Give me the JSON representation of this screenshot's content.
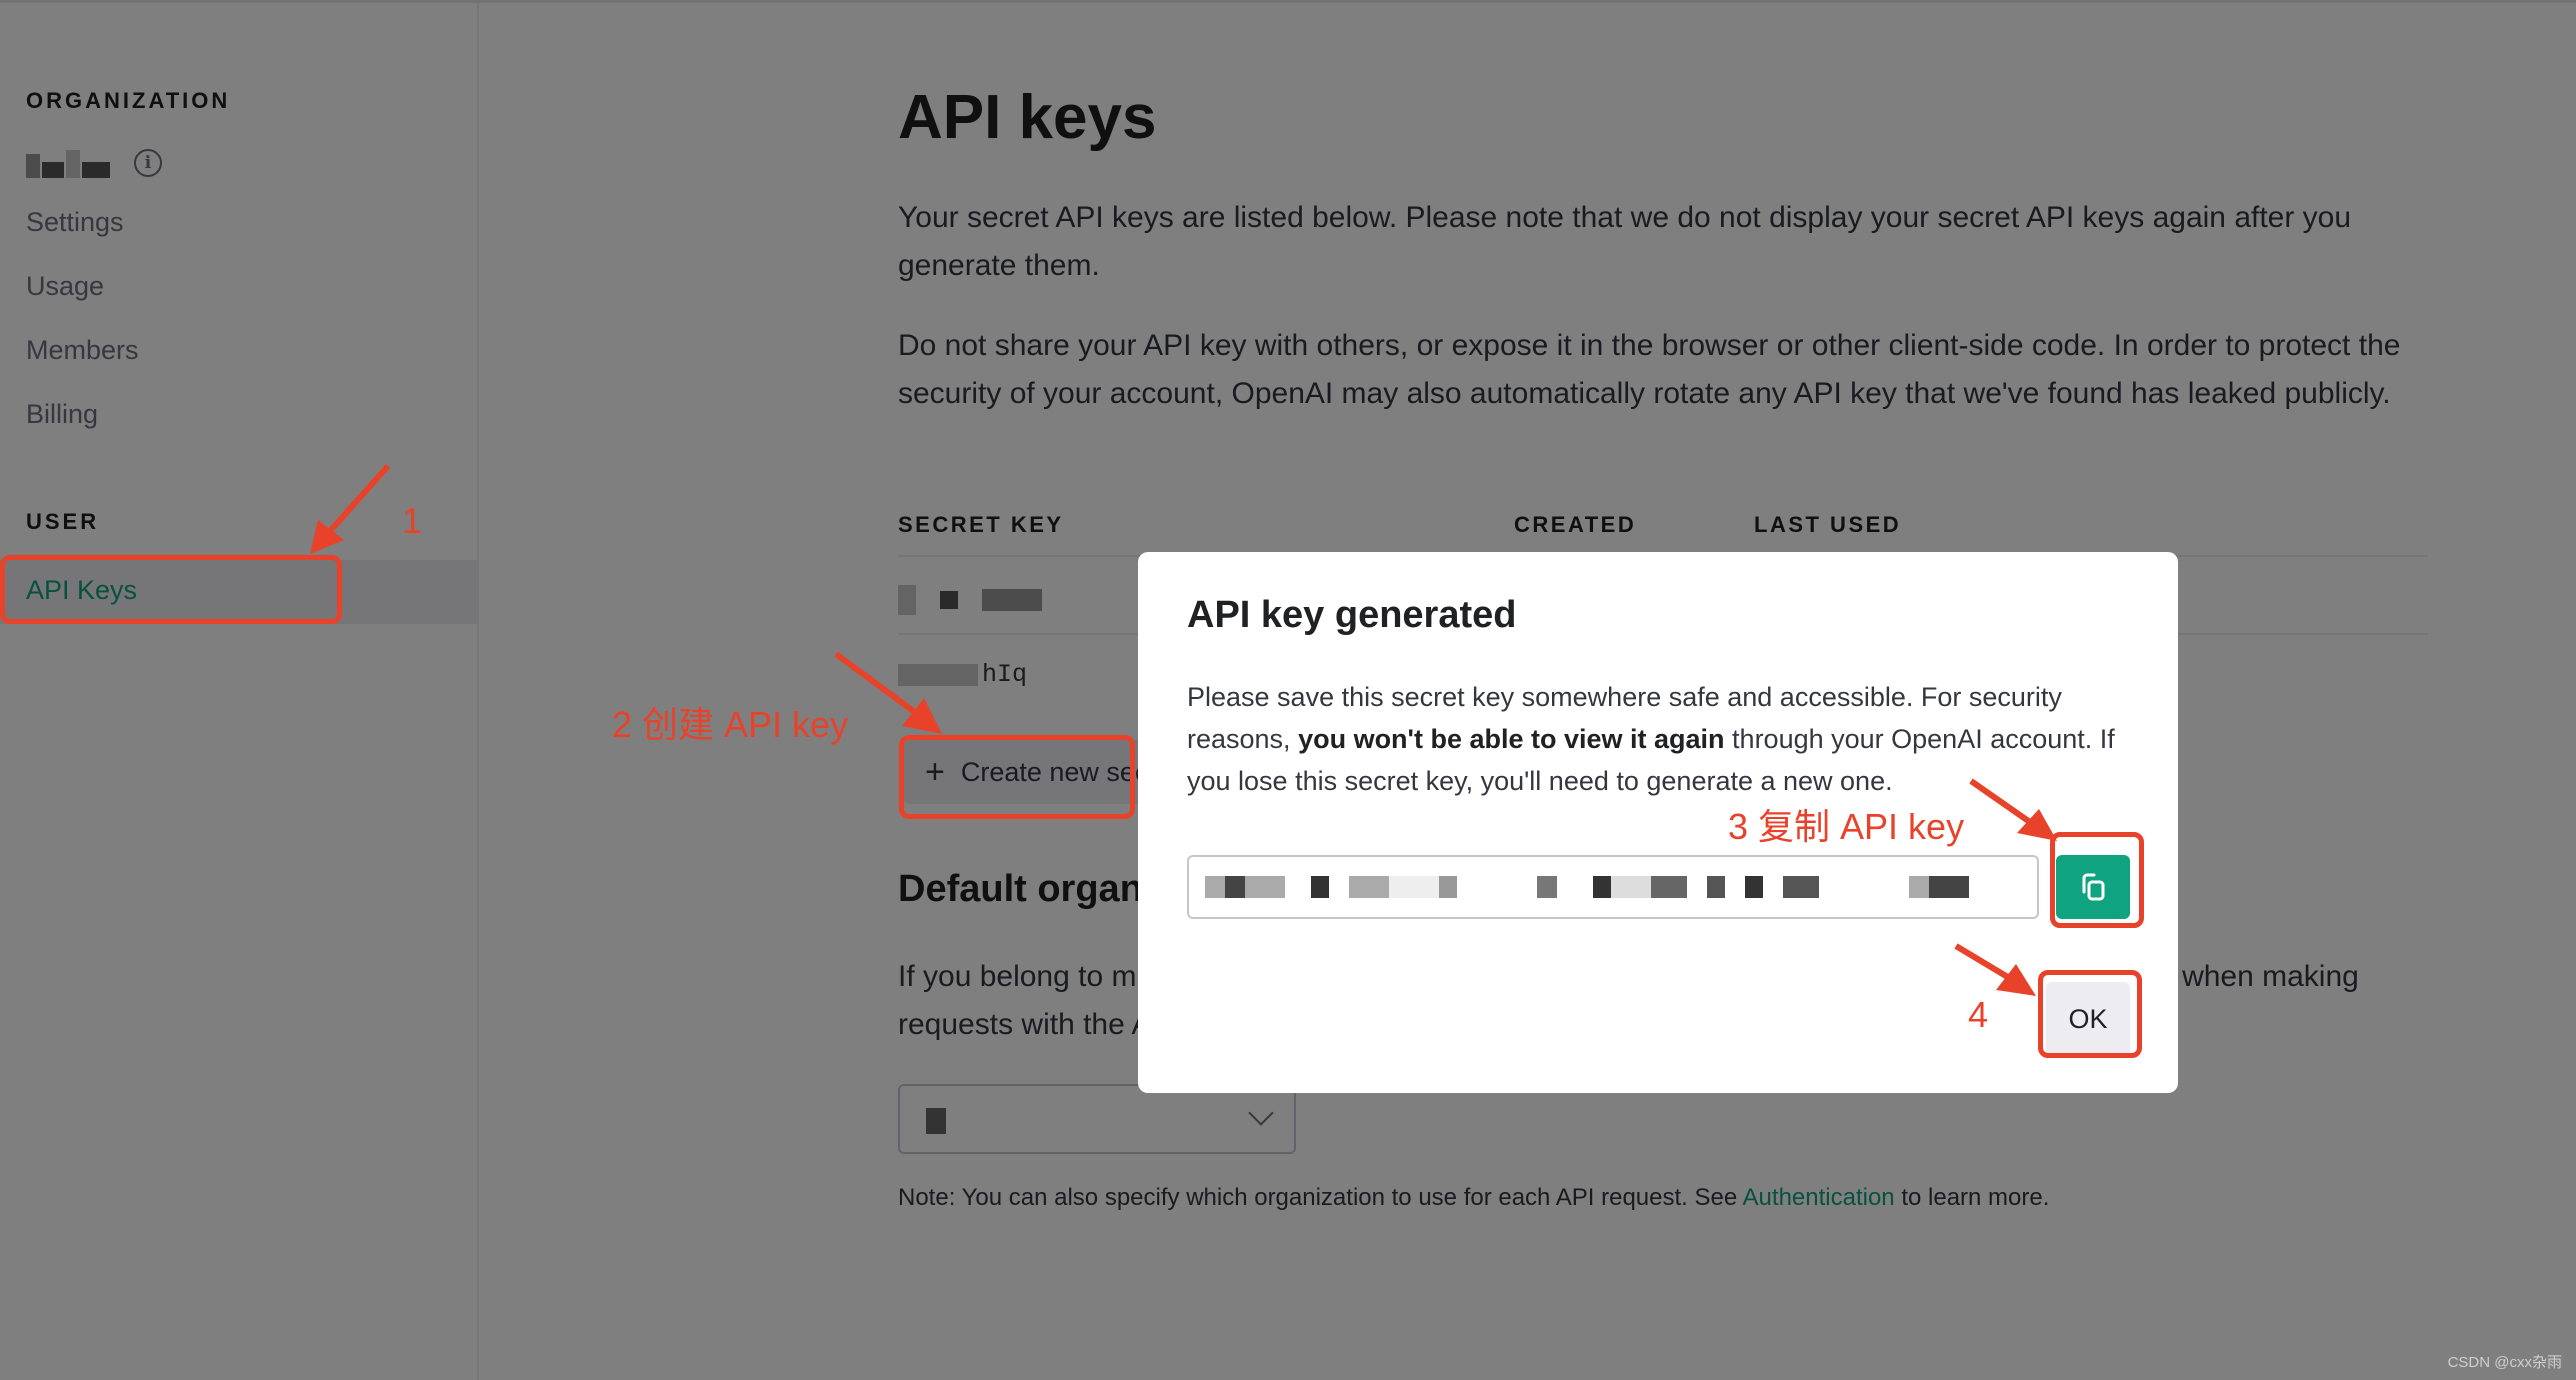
{
  "sidebar": {
    "org_heading": "ORGANIZATION",
    "org_name": "(redacted)",
    "items": [
      {
        "label": "Settings"
      },
      {
        "label": "Usage"
      },
      {
        "label": "Members"
      },
      {
        "label": "Billing"
      }
    ],
    "user_heading": "USER",
    "active_item": "API Keys"
  },
  "main": {
    "title": "API keys",
    "intro_1": "Your secret API keys are listed below. Please note that we do not display your secret API keys again after you generate them.",
    "intro_2": "Do not share your API key with others, or expose it in the browser or other client-side code. In order to protect the security of your account, OpenAI may also automatically rotate any API key that we've found has leaked publicly.",
    "table": {
      "columns": [
        "SECRET KEY",
        "CREATED",
        "LAST USED"
      ],
      "rows": [
        {
          "key_suffix": ""
        },
        {
          "key_suffix": "hIq"
        }
      ]
    },
    "create_button": "Create new secret key",
    "default_org_title": "Default organization",
    "default_org_text": "If you belong to multiple organizations, this setting controls which organization is used by default when making requests with the API keys above.",
    "select_value": "(redacted)",
    "note_prefix": "Note: You can also specify which organization to use for each API request. See ",
    "note_link": "Authentication",
    "note_suffix": " to learn more."
  },
  "modal": {
    "title": "API key generated",
    "body_pre": "Please save this secret key somewhere safe and accessible. For security reasons, ",
    "body_bold": "you won't be able to view it again",
    "body_post": " through your OpenAI account. If you lose this secret key, you'll need to generate a new one.",
    "key_value": "(redacted key)",
    "copy_icon": "copy-icon",
    "ok_button": "OK"
  },
  "annotations": {
    "step1": "1",
    "step2": "2 创建 API key",
    "step3": "3 复制 API key",
    "step4": "4"
  },
  "watermark": "CSDN @cxx杂雨",
  "colors": {
    "accent": "#10a37f",
    "annotation": "#e8432a",
    "overlay": "rgba(0,0,0,0.5)"
  }
}
